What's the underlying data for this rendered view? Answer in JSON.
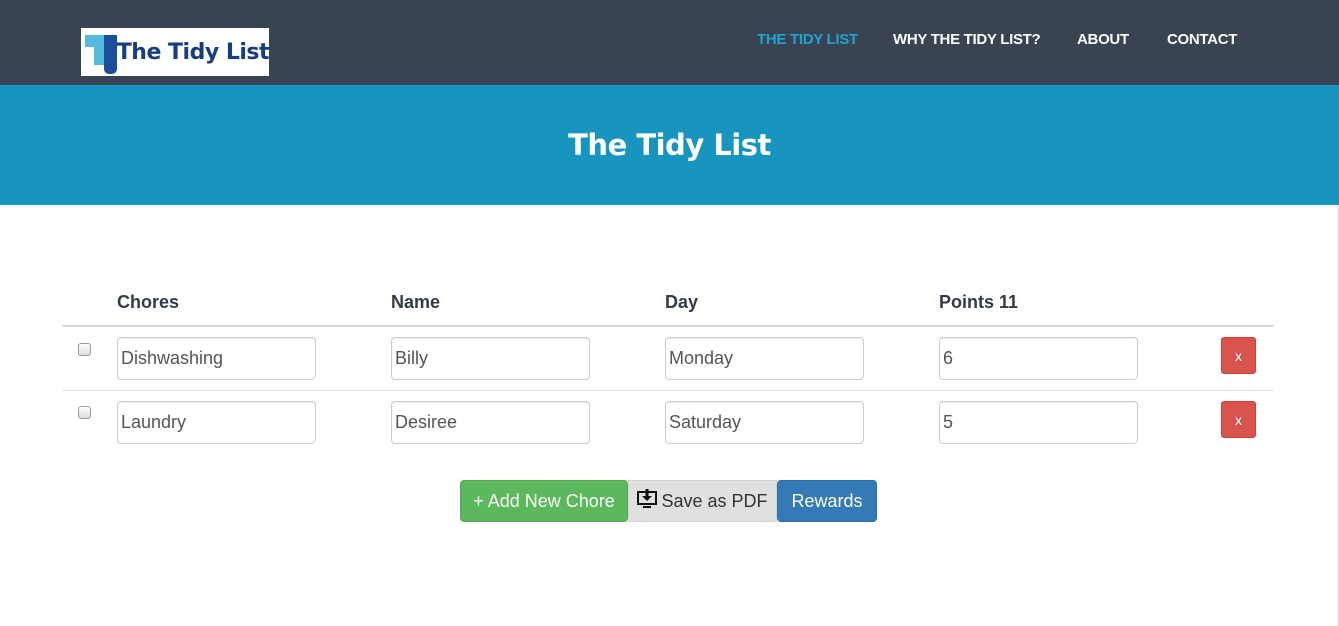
{
  "brand": {
    "logo_text": "The Tidy List"
  },
  "nav": {
    "items": [
      {
        "label": "THE TIDY LIST",
        "active": true
      },
      {
        "label": "WHY THE TIDY LIST?",
        "active": false
      },
      {
        "label": "ABOUT",
        "active": false
      },
      {
        "label": "CONTACT",
        "active": false
      }
    ]
  },
  "hero": {
    "title": "The Tidy List"
  },
  "table": {
    "headers": {
      "chores": "Chores",
      "name": "Name",
      "day": "Day",
      "points": "Points 11"
    },
    "rows": [
      {
        "checked": false,
        "chore": "Dishwashing",
        "name": "Billy",
        "day": "Monday",
        "points": "6",
        "delete_label": "x"
      },
      {
        "checked": false,
        "chore": "Laundry",
        "name": "Desiree",
        "day": "Saturday",
        "points": "5",
        "delete_label": "x"
      }
    ]
  },
  "actions": {
    "add_label": "+ Add New Chore",
    "pdf_label": "Save as PDF",
    "pdf_icon": "download-icon",
    "rewards_label": "Rewards"
  },
  "colors": {
    "navbar": "#394351",
    "nav_active": "#1ea5cf",
    "hero": "#1795bf",
    "add_button": "#5cb85c",
    "pdf_button": "#e0e0e0",
    "rewards_button": "#337ab7",
    "delete_button": "#d9534f"
  }
}
